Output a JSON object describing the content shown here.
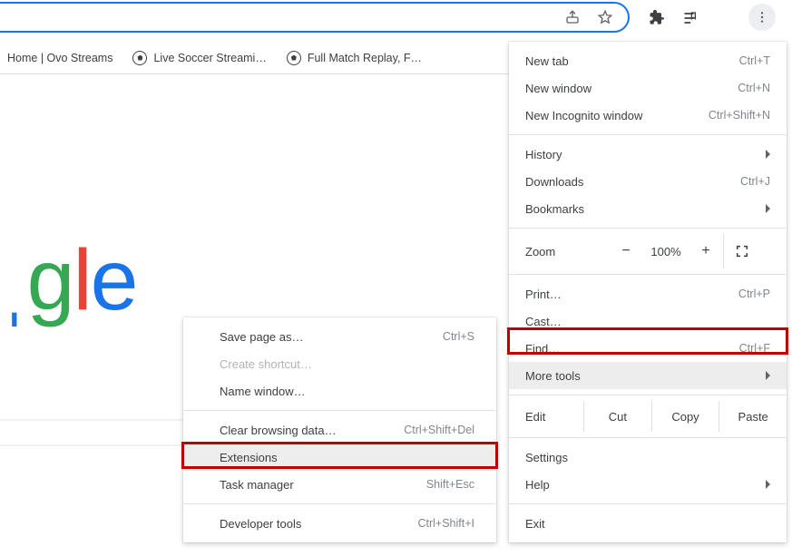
{
  "bookmarks": [
    {
      "label": "Home | Ovo Streams",
      "icon": false
    },
    {
      "label": "Live Soccer Streami…",
      "icon": true
    },
    {
      "label": "Full Match Replay, F…",
      "icon": true
    }
  ],
  "menu": {
    "new_tab": {
      "label": "New tab",
      "shortcut": "Ctrl+T"
    },
    "new_window": {
      "label": "New window",
      "shortcut": "Ctrl+N"
    },
    "incognito": {
      "label": "New Incognito window",
      "shortcut": "Ctrl+Shift+N"
    },
    "history": {
      "label": "History"
    },
    "downloads": {
      "label": "Downloads",
      "shortcut": "Ctrl+J"
    },
    "bookmarks": {
      "label": "Bookmarks"
    },
    "zoom": {
      "label": "Zoom",
      "minus": "−",
      "value": "100%",
      "plus": "+"
    },
    "print": {
      "label": "Print…",
      "shortcut": "Ctrl+P"
    },
    "cast": {
      "label": "Cast…"
    },
    "find": {
      "label": "Find…",
      "shortcut": "Ctrl+F"
    },
    "more_tools": {
      "label": "More tools"
    },
    "edit": {
      "label": "Edit",
      "cut": "Cut",
      "copy": "Copy",
      "paste": "Paste"
    },
    "settings": {
      "label": "Settings"
    },
    "help": {
      "label": "Help"
    },
    "exit": {
      "label": "Exit"
    }
  },
  "submenu": {
    "save_as": {
      "label": "Save page as…",
      "shortcut": "Ctrl+S"
    },
    "create_shortcut": {
      "label": "Create shortcut…"
    },
    "name_window": {
      "label": "Name window…"
    },
    "clear_data": {
      "label": "Clear browsing data…",
      "shortcut": "Ctrl+Shift+Del"
    },
    "extensions": {
      "label": "Extensions"
    },
    "task_manager": {
      "label": "Task manager",
      "shortcut": "Shift+Esc"
    },
    "dev_tools": {
      "label": "Developer tools",
      "shortcut": "Ctrl+Shift+I"
    }
  },
  "logo_fragment": "ˌgle"
}
